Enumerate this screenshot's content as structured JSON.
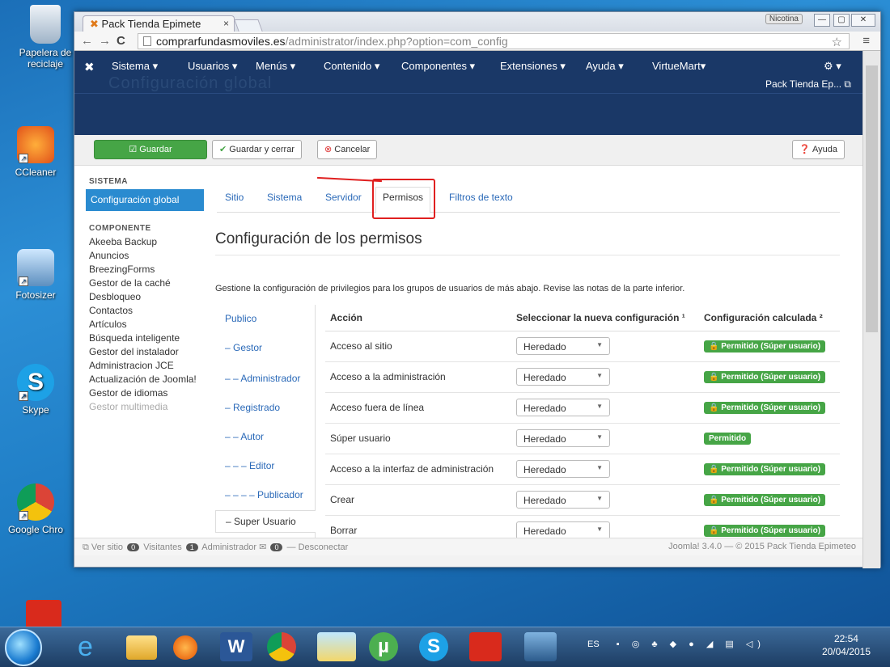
{
  "desktop": {
    "icons": [
      {
        "label": "Papelera de reciclaje",
        "icon": "recycle-bin-icon"
      },
      {
        "label": "CCleaner",
        "icon": "ccleaner-icon"
      },
      {
        "label": "Fotosizer",
        "icon": "fotosizer-icon"
      },
      {
        "label": "Skype",
        "icon": "skype-icon"
      },
      {
        "label": "Google Chro",
        "icon": "chrome-icon"
      }
    ]
  },
  "browser": {
    "tab_title": "Pack Tienda Epimete",
    "user_badge": "Nicotina",
    "url_host": "comprarfundasmoviles.es",
    "url_path": "/administrator/index.php?option=com_config"
  },
  "joomla": {
    "menu": [
      "Sistema ▾",
      "Usuarios ▾",
      "Menús ▾",
      "Contenido ▾",
      "Componentes ▾",
      "Extensiones ▾",
      "Ayuda ▾",
      "VirtueMart▾"
    ],
    "site_name": "Pack Tienda Ep...",
    "header_faded": "Configuración global",
    "toolbar": {
      "save": "Guardar",
      "save_close": "Guardar y cerrar",
      "cancel": "Cancelar",
      "help": "Ayuda"
    },
    "sidebar": {
      "sistema_heading": "SISTEMA",
      "active": "Configuración global",
      "componente_heading": "COMPONENTE",
      "items": [
        "Akeeba Backup",
        "Anuncios",
        "BreezingForms",
        "Gestor de la caché",
        "Desbloqueo",
        "Contactos",
        "Artículos",
        "Búsqueda inteligente",
        "Gestor del instalador",
        "Administracion JCE",
        "Actualización de Joomla!",
        "Gestor de idiomas",
        "Gestor multimedia"
      ]
    },
    "tabs": [
      "Sitio",
      "Sistema",
      "Servidor",
      "Permisos",
      "Filtros de texto"
    ],
    "page_title": "Configuración de los permisos",
    "description": "Gestione la configuración de privilegios para los grupos de usuarios de más abajo. Revise las notas de la parte inferior.",
    "groups": [
      "Publico",
      "– Gestor",
      "– – Administrador",
      "– Registrado",
      "– – Autor",
      "– – – Editor",
      "– – – – Publicador",
      "– Super Usuario"
    ],
    "table": {
      "headers": [
        "Acción",
        "Seleccionar la nueva configuración ¹",
        "Configuración calculada ²"
      ],
      "rows": [
        {
          "action": "Acceso al sitio",
          "select": "Heredado",
          "calc": "Permitido (Súper usuario)"
        },
        {
          "action": "Acceso a la administración",
          "select": "Heredado",
          "calc": "Permitido (Súper usuario)"
        },
        {
          "action": "Acceso fuera de línea",
          "select": "Heredado",
          "calc": "Permitido (Súper usuario)"
        },
        {
          "action": "Súper usuario",
          "select": "Heredado",
          "calc": "Permitido"
        },
        {
          "action": "Acceso a la interfaz de administración",
          "select": "Heredado",
          "calc": "Permitido (Súper usuario)"
        },
        {
          "action": "Crear",
          "select": "Heredado",
          "calc": "Permitido (Súper usuario)"
        },
        {
          "action": "Borrar",
          "select": "Heredado",
          "calc": "Permitido (Súper usuario)"
        }
      ]
    },
    "status": {
      "view_site": "Ver sitio",
      "visitors_count": "0",
      "visitors": "Visitantes",
      "admin_count": "1",
      "admin": "Administrador",
      "msg_count": "0",
      "logout": "Desconectar",
      "footer": "Joomla! 3.4.0 — © 2015 Pack Tienda Epimeteo"
    }
  },
  "taskbar": {
    "lang": "ES",
    "time": "22:54",
    "date": "20/04/2015"
  },
  "colors": {
    "navbar": "#1a3867",
    "save_green": "#46a546",
    "active_blue": "#2a8bd0",
    "annotation_red": "#e02020"
  }
}
